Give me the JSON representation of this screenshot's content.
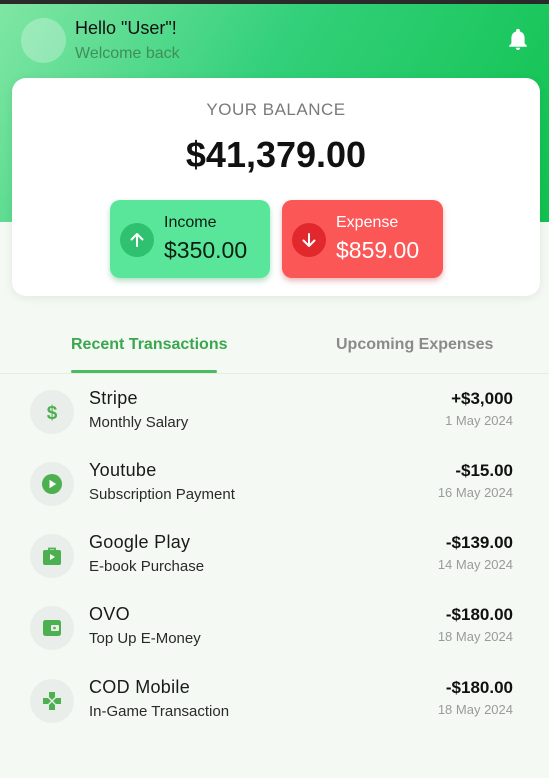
{
  "header": {
    "greeting": "Hello \"User\"!",
    "welcome": "Welcome back"
  },
  "balance": {
    "label": "YOUR BALANCE",
    "amount": "$41,379.00"
  },
  "income": {
    "label": "Income",
    "value": "$350.00"
  },
  "expense": {
    "label": "Expense",
    "value": "$859.00"
  },
  "tabs": [
    {
      "label": "Recent Transactions",
      "active": true
    },
    {
      "label": "Upcoming Expenses",
      "active": false
    }
  ],
  "transactions": [
    {
      "name": "Stripe",
      "description": "Monthly Salary",
      "amount": "+$3,000",
      "date": "1 May 2024",
      "icon": "dollar-icon"
    },
    {
      "name": "Youtube",
      "description": "Subscription Payment",
      "amount": "-$15.00",
      "date": "16 May 2024",
      "icon": "play-icon"
    },
    {
      "name": "Google Play",
      "description": "E-book Purchase",
      "amount": "-$139.00",
      "date": "14 May 2024",
      "icon": "shop-bag-icon"
    },
    {
      "name": "OVO",
      "description": "Top Up E-Money",
      "amount": "-$180.00",
      "date": "18 May 2024",
      "icon": "wallet-icon"
    },
    {
      "name": "COD Mobile",
      "description": "In-Game Transaction",
      "amount": "-$180.00",
      "date": "18 May 2024",
      "icon": "gamepad-icon"
    }
  ],
  "colors": {
    "accent": "#4cbb5e",
    "income": "#59e69a",
    "expense": "#fb5757"
  }
}
